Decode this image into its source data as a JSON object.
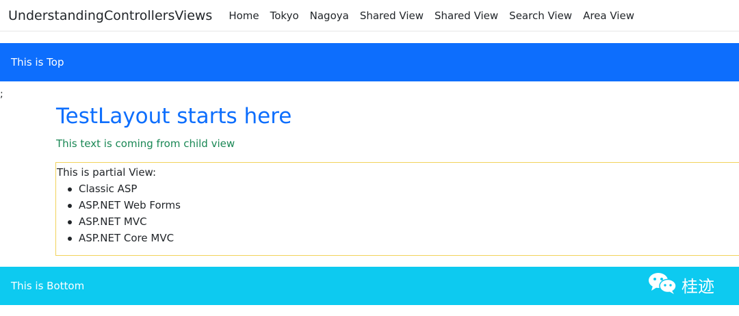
{
  "navbar": {
    "brand": "UnderstandingControllersViews",
    "links": [
      "Home",
      "Tokyo",
      "Nagoya",
      "Shared View",
      "Shared View",
      "Search View",
      "Area View"
    ]
  },
  "top_band": {
    "text": "This is Top"
  },
  "stray_char": ";",
  "content": {
    "title": "TestLayout starts here",
    "child_text": "This text is coming from child view",
    "partial": {
      "heading": "This is partial View:",
      "items": [
        "Classic ASP",
        "ASP.NET Web Forms",
        "ASP.NET MVC",
        "ASP.NET Core MVC"
      ]
    }
  },
  "bottom_band": {
    "text": "This is Bottom"
  },
  "watermark": {
    "text": "桂迹",
    "icon": "wechat-icon"
  },
  "colors": {
    "primary": "#0d6efd",
    "info": "#0dcaf0",
    "success": "#198754",
    "warning_border": "#f2d25a"
  }
}
